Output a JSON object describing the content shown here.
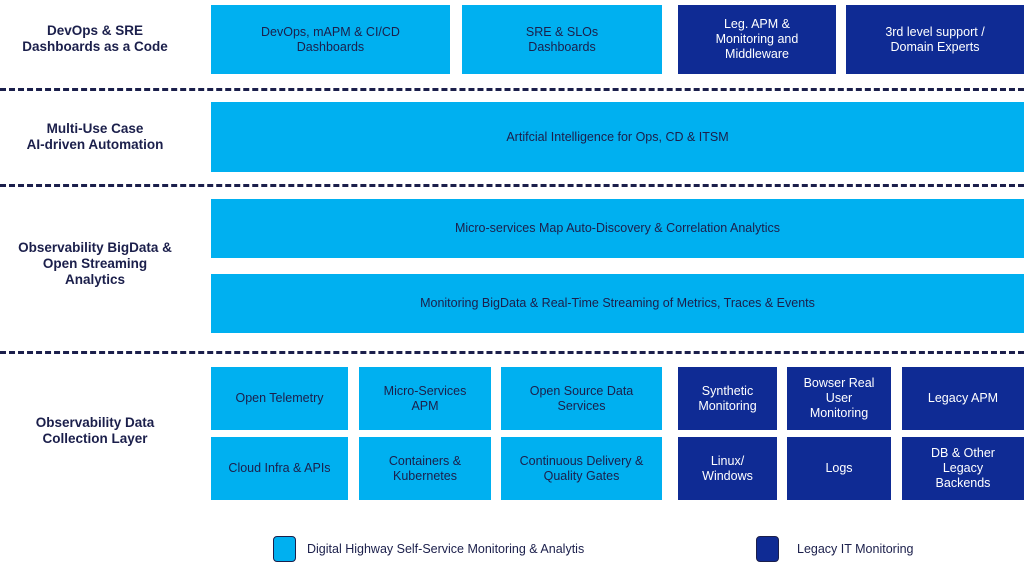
{
  "colors": {
    "self_service": "#00b0f0",
    "legacy": "#0f2b94",
    "text": "#1b1f4b"
  },
  "layers": [
    {
      "label": "DevOps & SRE\nDashboards as a Code",
      "boxes": [
        "DevOps, mAPM & CI/CD\nDashboards",
        "SRE & SLOs\nDashboards",
        "Leg. APM &\nMonitoring and\nMiddleware",
        "3rd level support /\nDomain Experts"
      ]
    },
    {
      "label": "Multi-Use Case\nAI-driven Automation",
      "boxes": [
        "Artifcial Intelligence for Ops, CD & ITSM"
      ]
    },
    {
      "label": "Observability BigData &\nOpen Streaming\nAnalytics",
      "boxes": [
        "Micro-services Map Auto-Discovery &  Correlation Analytics",
        "Monitoring BigData & Real-Time Streaming of Metrics, Traces & Events"
      ]
    },
    {
      "label": "Observability Data\nCollection Layer",
      "boxes": [
        "Open Telemetry",
        "Micro-Services\nAPM",
        "Open Source Data\nServices",
        "Synthetic\nMonitoring",
        "Bowser Real\nUser\nMonitoring",
        "Legacy APM",
        "Cloud Infra & APIs",
        "Containers &\nKubernetes",
        "Continuous Delivery &\nQuality Gates",
        "Linux/\nWindows",
        "Logs",
        "DB & Other\nLegacy\nBackends"
      ]
    }
  ],
  "legend": [
    {
      "label": "Digital Highway Self-Service Monitoring & Analytis"
    },
    {
      "label": "Legacy IT Monitoring"
    }
  ]
}
